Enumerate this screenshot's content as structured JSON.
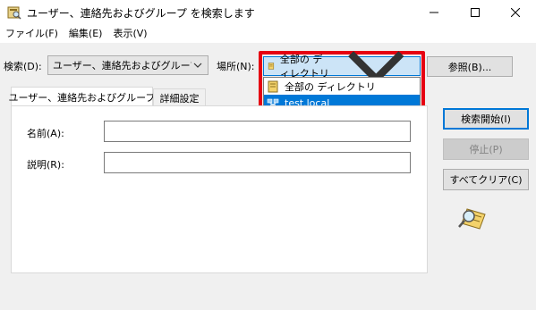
{
  "window": {
    "title": "ユーザー、連絡先およびグループ を検索します"
  },
  "menu": {
    "items": [
      {
        "label": "ファイル(F)"
      },
      {
        "label": "編集(E)"
      },
      {
        "label": "表示(V)"
      }
    ]
  },
  "search": {
    "find_label": "検索(D):",
    "find_value": "ユーザー、連絡先およびグループ",
    "in_label": "場所(N):",
    "in_value": "全部の ディレクトリ",
    "browse_label": "参照(B)..."
  },
  "dropdown": {
    "options": [
      {
        "label": "全部の ディレクトリ",
        "icon": "directory-icon",
        "selected": false
      },
      {
        "label": "test.local",
        "icon": "domain-icon",
        "selected": true
      }
    ]
  },
  "tabs": [
    {
      "label": "ユーザー、連絡先およびグループ",
      "active": true
    },
    {
      "label": "詳細設定",
      "active": false
    }
  ],
  "form": {
    "name_label": "名前(A):",
    "name_value": "",
    "description_label": "説明(R):",
    "description_value": ""
  },
  "actions": {
    "find_now": "検索開始(I)",
    "stop": "停止(P)",
    "clear_all": "すべてクリア(C)"
  },
  "colors": {
    "accent": "#0078d7",
    "highlight_frame": "#e60012"
  }
}
